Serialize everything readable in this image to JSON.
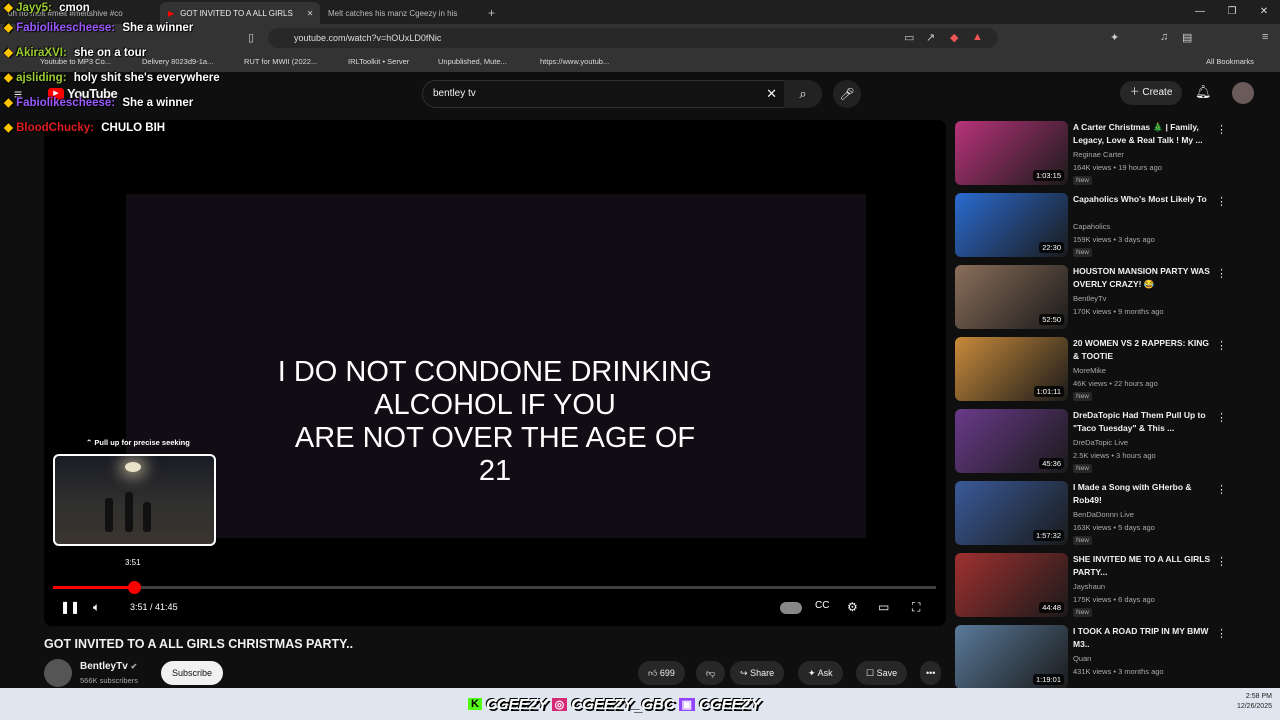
{
  "browser": {
    "tabs": [
      {
        "label": "oh no melt  #melt #meltshive #co",
        "active": false
      },
      {
        "label": "GOT INVITED TO A ALL GIRLS",
        "active": true
      },
      {
        "label": "Melt catches his manz Cgeezy in his",
        "active": false
      }
    ],
    "url": "youtube.com/watch?v=hOUxLD0fNic",
    "bookmarks": [
      "Youtube to MP3 Co...",
      "Delivery 8023d9-1a...",
      "RUT for MWII (2022...",
      "IRLToolkit • Server",
      "Unpublished, Mute...",
      "https://www.youtub..."
    ],
    "all_bookmarks": "All Bookmarks"
  },
  "youtube": {
    "logo": "YouTube",
    "search_value": "bentley tv",
    "create_label": "Create"
  },
  "video": {
    "overlay_text": [
      "I DO NOT CONDONE DRINKING",
      "ALCOHOL IF YOU",
      "ARE NOT OVER THE AGE OF",
      "21"
    ],
    "preview_hint": "Pull up for precise seeking",
    "preview_time": "3:51",
    "time_current": "3:51",
    "time_total": "41:45",
    "progress_fraction": 0.092,
    "title": "GOT INVITED TO A ALL GIRLS CHRISTMAS PARTY..",
    "channel": "BentleyTv",
    "subscribers": "566K subscribers",
    "subscribe_label": "Subscribe",
    "likes": "699",
    "share_label": "Share",
    "ask_label": "Ask",
    "save_label": "Save"
  },
  "recommendations": [
    {
      "title": "A Carter Christmas 🎄 | Family, Legacy, Love & Real Talk ! My ...",
      "channel": "Reginae Carter",
      "meta": "164K views • 19 hours ago",
      "new": "New",
      "duration": "1:03:15",
      "thumb_color": "#b8337a"
    },
    {
      "title": "Capaholics Who's Most Likely To",
      "channel": "Capaholics",
      "meta": "159K views • 3 days ago",
      "new": "New",
      "duration": "22:30",
      "thumb_color": "#2a6bd0"
    },
    {
      "title": "HOUSTON MANSION PARTY WAS OVERLY CRAZY! 😂",
      "channel": "BentleyTv",
      "meta": "170K views • 9 months ago",
      "new": "",
      "duration": "52:50",
      "thumb_color": "#8a6e5a"
    },
    {
      "title": "20 WOMEN VS 2 RAPPERS: KING & TOOTIE",
      "channel": "MoreMike",
      "meta": "46K views • 22 hours ago",
      "new": "New",
      "duration": "1:01:11",
      "thumb_color": "#c98a3a"
    },
    {
      "title": "DreDaTopic Had Them Pull Up to \"Taco Tuesday\" & This ...",
      "channel": "DreDaTopic Live",
      "meta": "2.5K views • 3 hours ago",
      "new": "New",
      "duration": "45:36",
      "thumb_color": "#6a3a8a"
    },
    {
      "title": "I Made a Song with GHerbo & Rob49!",
      "channel": "BenDaDonnn Live",
      "meta": "163K views • 5 days ago",
      "new": "New",
      "duration": "1:57:32",
      "thumb_color": "#3a5a9a"
    },
    {
      "title": "SHE INVITED ME TO A ALL GIRLS PARTY...",
      "channel": "Jayshaun",
      "meta": "175K views • 6 days ago",
      "new": "New",
      "duration": "44:48",
      "thumb_color": "#a03030"
    },
    {
      "title": "I TOOK A ROAD TRIP IN MY BMW M3..",
      "channel": "Quan",
      "meta": "431K views • 3 months ago",
      "new": "",
      "duration": "1:19:01",
      "thumb_color": "#5a7a9a"
    }
  ],
  "chat": [
    {
      "user": "Jayy5:",
      "msg": "cmon",
      "color": "#9acd32"
    },
    {
      "user": "Fabiolikescheese:",
      "msg": "She a winner",
      "color": "#9b59ff"
    },
    {
      "user": "AkiraXVI:",
      "msg": "she on a tour",
      "color": "#9acd32"
    },
    {
      "user": "ajsliding:",
      "msg": "holy shit she's everywhere",
      "color": "#9acd32"
    },
    {
      "user": "Fabiolikescheese:",
      "msg": "She a winner",
      "color": "#9b59ff"
    },
    {
      "user": "BloodChucky:",
      "msg": "CHULO BIH",
      "color": "#e01e1e"
    }
  ],
  "banner": {
    "handles": [
      "CGEEZY",
      "CGEEZY_GBC",
      "CGEEZY"
    ]
  },
  "tray": {
    "time": "2:58 PM",
    "date": "12/26/2025"
  }
}
